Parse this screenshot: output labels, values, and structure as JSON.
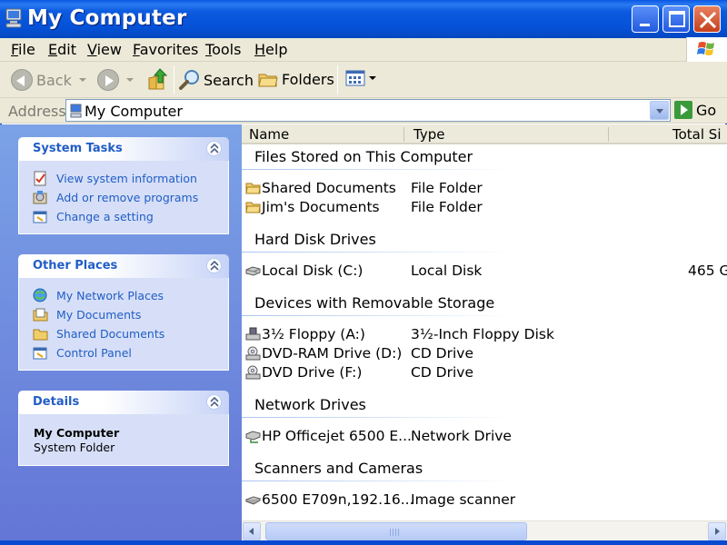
{
  "window": {
    "title": "My Computer"
  },
  "menubar": {
    "items": [
      {
        "label": "File",
        "mnemonic": "F",
        "rest": "ile"
      },
      {
        "label": "Edit",
        "mnemonic": "E",
        "rest": "dit"
      },
      {
        "label": "View",
        "mnemonic": "V",
        "rest": "iew"
      },
      {
        "label": "Favorites",
        "mnemonic": "F",
        "rest": "avorites"
      },
      {
        "label": "Tools",
        "mnemonic": "T",
        "rest": "ools"
      },
      {
        "label": "Help",
        "mnemonic": "H",
        "rest": "elp"
      }
    ]
  },
  "toolbar": {
    "back_label": "Back",
    "search_label": "Search",
    "folders_label": "Folders"
  },
  "address": {
    "label": "Address",
    "value": "My Computer",
    "go_label": "Go"
  },
  "tasks": {
    "system": {
      "title": "System Tasks",
      "items": [
        "View system information",
        "Add or remove programs",
        "Change a setting"
      ]
    },
    "other": {
      "title": "Other Places",
      "items": [
        "My Network Places",
        "My Documents",
        "Shared Documents",
        "Control Panel"
      ]
    },
    "details": {
      "title": "Details",
      "name": "My Computer",
      "type": "System Folder"
    }
  },
  "columns": {
    "name": "Name",
    "type": "Type",
    "total_size": "Total Si"
  },
  "groups": {
    "files": {
      "label": "Files Stored on This Computer",
      "rows": [
        {
          "name": "Shared Documents",
          "type": "File Folder"
        },
        {
          "name": "Jim's Documents",
          "type": "File Folder"
        }
      ]
    },
    "hdd": {
      "label": "Hard Disk Drives",
      "rows": [
        {
          "name": "Local Disk (C:)",
          "type": "Local Disk",
          "size": "465 G"
        }
      ]
    },
    "removable": {
      "label": "Devices with Removable Storage",
      "rows": [
        {
          "name": "3½ Floppy (A:)",
          "type": "3½-Inch Floppy Disk"
        },
        {
          "name": "DVD-RAM Drive (D:)",
          "type": "CD Drive"
        },
        {
          "name": "DVD Drive (F:)",
          "type": "CD Drive"
        }
      ]
    },
    "network": {
      "label": "Network Drives",
      "rows": [
        {
          "name": "HP Officejet 6500 E...",
          "type": "Network Drive"
        }
      ]
    },
    "scanners": {
      "label": "Scanners and Cameras",
      "rows": [
        {
          "name": "6500 E709n,192.16...",
          "type": "Image scanner"
        }
      ]
    }
  }
}
